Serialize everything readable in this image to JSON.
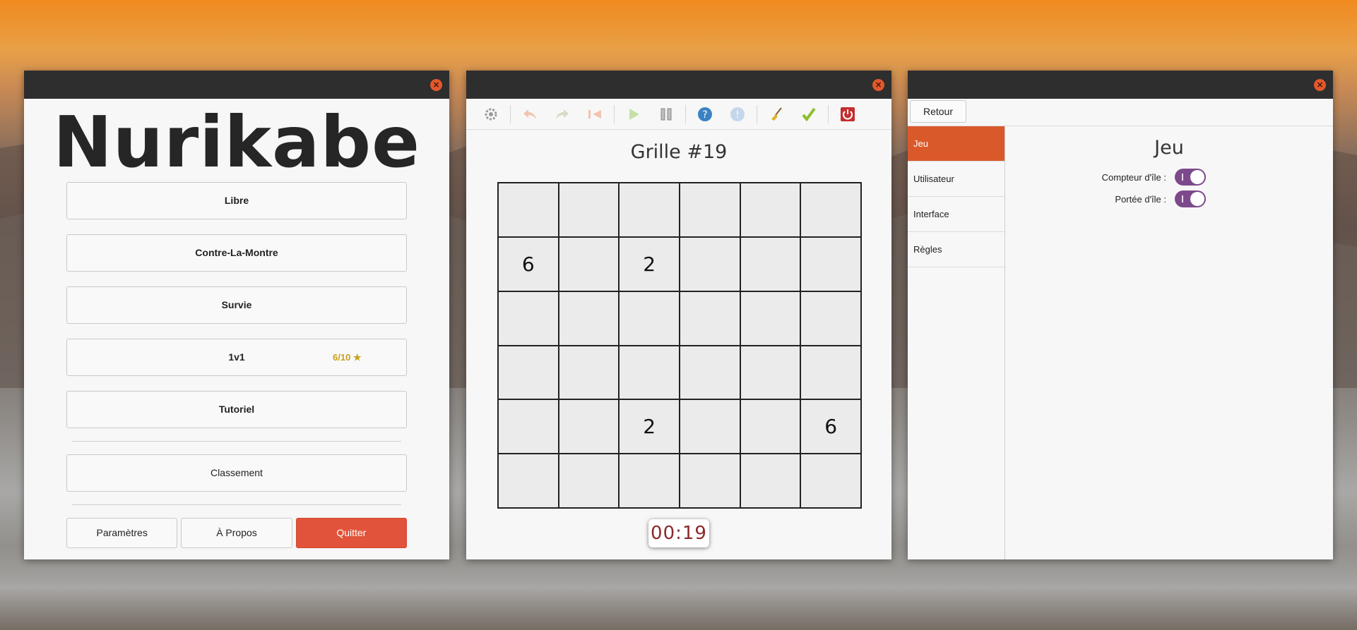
{
  "menu_window": {
    "logo": "Nurikabe",
    "buttons": {
      "libre": "Libre",
      "contre_la_montre": "Contre-La-Montre",
      "survie": "Survie",
      "one_v_one": "1v1",
      "one_v_one_stars": "6/10 ★",
      "tutoriel": "Tutoriel",
      "classement": "Classement",
      "parametres": "Paramètres",
      "a_propos": "À Propos",
      "quitter": "Quitter"
    }
  },
  "game_window": {
    "title": "Grille #19",
    "toolbar_icons": [
      "gear-icon",
      "undo-icon",
      "redo-icon",
      "reset-icon",
      "play-icon",
      "pause-icon",
      "help-icon",
      "hint-icon",
      "broom-icon",
      "check-icon",
      "power-icon"
    ],
    "grid": [
      [
        "",
        "",
        "",
        "",
        "",
        ""
      ],
      [
        "6",
        "",
        "2",
        "",
        "",
        ""
      ],
      [
        "",
        "",
        "",
        "",
        "",
        ""
      ],
      [
        "",
        "",
        "",
        "",
        "",
        ""
      ],
      [
        "",
        "",
        "2",
        "",
        "",
        "6"
      ],
      [
        "",
        "",
        "",
        "",
        "",
        ""
      ]
    ],
    "timer": "00:19"
  },
  "settings_window": {
    "back": "Retour",
    "sidebar": [
      "Jeu",
      "Utilisateur",
      "Interface",
      "Règles"
    ],
    "active_tab": "Jeu",
    "panel_title": "Jeu",
    "options": [
      {
        "label": "Compteur d'île :",
        "enabled": true
      },
      {
        "label": "Portée d'île :",
        "enabled": true
      }
    ]
  },
  "colors": {
    "accent": "#d9592b",
    "quit": "#e1533a",
    "toggle": "#7c4a8b",
    "timer_text": "#8b2a2a",
    "stars": "#c9a11b"
  }
}
